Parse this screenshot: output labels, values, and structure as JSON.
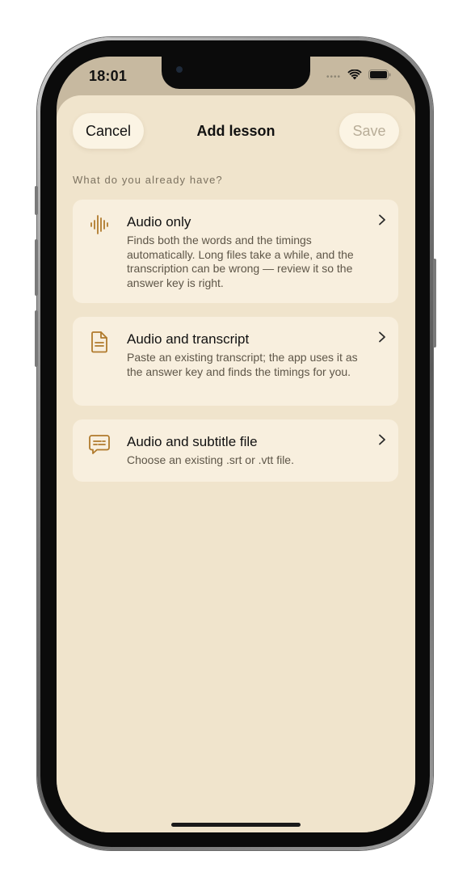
{
  "status_bar": {
    "time": "18:01",
    "signal_dots": "••••",
    "wifi_icon": "wifi-icon",
    "battery_icon": "battery-icon"
  },
  "nav": {
    "cancel_label": "Cancel",
    "title": "Add lesson",
    "save_label": "Save",
    "save_enabled": false
  },
  "section_label": "What do you already have?",
  "options": [
    {
      "icon": "audio-waveform-icon",
      "title": "Audio only",
      "description": "Finds both the words and the timings automatically. Long files take a while, and the transcription can be wrong — review it so the answer key is right."
    },
    {
      "icon": "document-icon",
      "title": "Audio and transcript",
      "description": "Paste an existing transcript; the app uses it as the answer key and finds the timings for you."
    },
    {
      "icon": "subtitle-bubble-icon",
      "title": "Audio and subtitle file",
      "description": "Choose an existing .srt or .vtt file."
    }
  ],
  "colors": {
    "sheet_background": "#f0e4cc",
    "card_background": "#f8efde",
    "accent_icon": "#b07a2c",
    "disabled_text": "#b8ad98"
  }
}
